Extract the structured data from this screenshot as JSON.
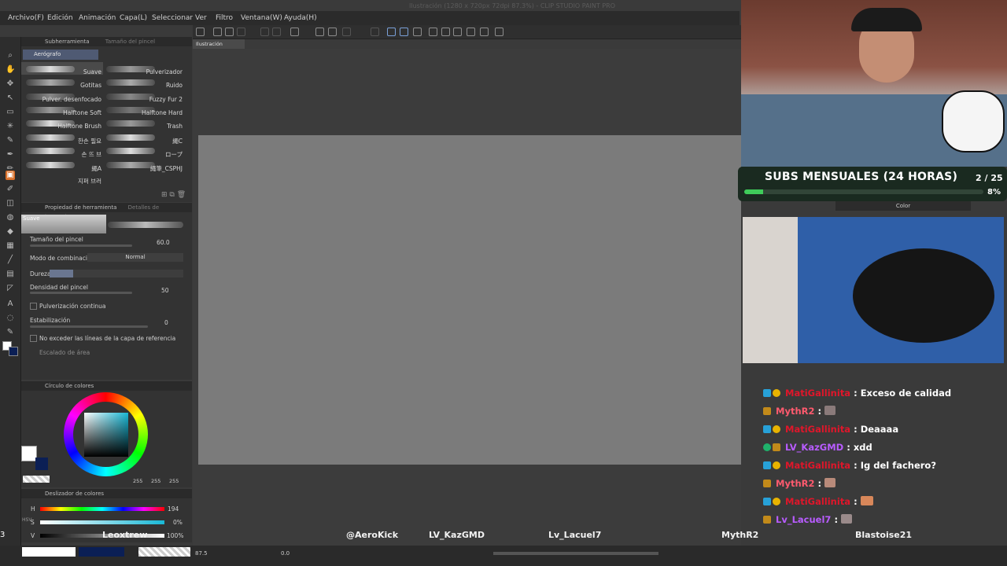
{
  "app": {
    "title": "Ilustración (1280 x 720px 72dpi 87.3%) - CLIP STUDIO PAINT PRO"
  },
  "menu": [
    "Archivo(F)",
    "Edición",
    "Animación",
    "Capa(L)",
    "Seleccionar",
    "Ver",
    "Filtro",
    "Ventana(W)",
    "Ayuda(H)"
  ],
  "subtool_panel": {
    "tabs": [
      "Subherramienta",
      "Tamaño del pincel"
    ],
    "group": "Aerógrafo",
    "brushes": [
      {
        "name": "Suave",
        "col": "left"
      },
      {
        "name": "Pulverizador",
        "col": "right"
      },
      {
        "name": "Gotitas",
        "col": "left"
      },
      {
        "name": "Ruido",
        "col": "right"
      },
      {
        "name": "Pulver. desenfocado",
        "col": "left"
      },
      {
        "name": "Fuzzy Fur 2",
        "col": "right"
      },
      {
        "name": "Halftone Soft",
        "col": "left"
      },
      {
        "name": "Halftone Hard",
        "col": "right"
      },
      {
        "name": "Halftone Brush",
        "col": "left"
      },
      {
        "name": "Trash",
        "col": "right"
      },
      {
        "name": "한손 필요",
        "col": "left"
      },
      {
        "name": "繩C",
        "col": "right"
      },
      {
        "name": "손 뜨 브",
        "col": "left"
      },
      {
        "name": "ロープ",
        "col": "right"
      },
      {
        "name": "繩A",
        "col": "left"
      },
      {
        "name": "繩筆_CSPHJ",
        "col": "right"
      },
      {
        "name": "지퍼 브러",
        "col": "left"
      }
    ]
  },
  "property_panel": {
    "tabs": [
      "Propiedad de herramienta",
      "Detalles de herramienta"
    ],
    "preview_label": "Suave",
    "brush_size_label": "Tamaño del pincel",
    "brush_size_value": "60.0",
    "blend_mode_label": "Modo de combinación",
    "blend_mode_value": "Normal",
    "hardness_label": "Dureza",
    "density_label": "Densidad del pincel",
    "density_value": "50",
    "spray_label": "Pulverización continua",
    "stabilization_label": "Estabilización",
    "stabilization_value": "0",
    "ref_label": "No exceder las líneas de la capa de referencia",
    "area_label": "Escalado de área"
  },
  "color_panel": {
    "title": "Círculo de colores",
    "rgb": [
      "255",
      "255",
      "255"
    ],
    "hue_color": "#19b8d6"
  },
  "slider_panel": {
    "title": "Deslizador de colores",
    "h_label": "H",
    "h_value": "194",
    "s_label": "S",
    "s_value": "0%",
    "v_label": "V",
    "v_value": "100%",
    "side_label": "HSV"
  },
  "document_tab": "Ilustración",
  "zoom": "87.5",
  "rotation": "0.0",
  "stream": {
    "subs_label": "SUBS MENSUALES (24 HORAS)",
    "subs_count": "2 / 25",
    "subs_percent": "8%",
    "subs_progress": 0.08,
    "accent": "#3fcb5a",
    "layer_color_label": "Color"
  },
  "chat": [
    {
      "user": "MatiGallinita",
      "user_color": "#e0162a",
      "msg": ": Exceso de calidad"
    },
    {
      "user": "MythR2",
      "user_color": "#ff5a6e",
      "msg": ":"
    },
    {
      "user": "MatiGallinita",
      "user_color": "#e0162a",
      "msg": ": Deaaaa"
    },
    {
      "user": "LV_KazGMD",
      "user_color": "#b85cff",
      "msg": ": xdd"
    },
    {
      "user": "MatiGallinita",
      "user_color": "#e0162a",
      "msg": ": Ig del fachero?"
    },
    {
      "user": "MythR2",
      "user_color": "#ff5a6e",
      "msg": ":"
    },
    {
      "user": "MatiGallinita",
      "user_color": "#e0162a",
      "msg": ":"
    },
    {
      "user": "Lv_Lacuel7",
      "user_color": "#b85cff",
      "msg": ":"
    }
  ],
  "bottom_names": [
    "Leoxtrew",
    "@AeroKick",
    "LV_KazGMD",
    "Lv_Lacuel7",
    "MythR2",
    "Blastoise21"
  ],
  "left_edge_number": "3"
}
